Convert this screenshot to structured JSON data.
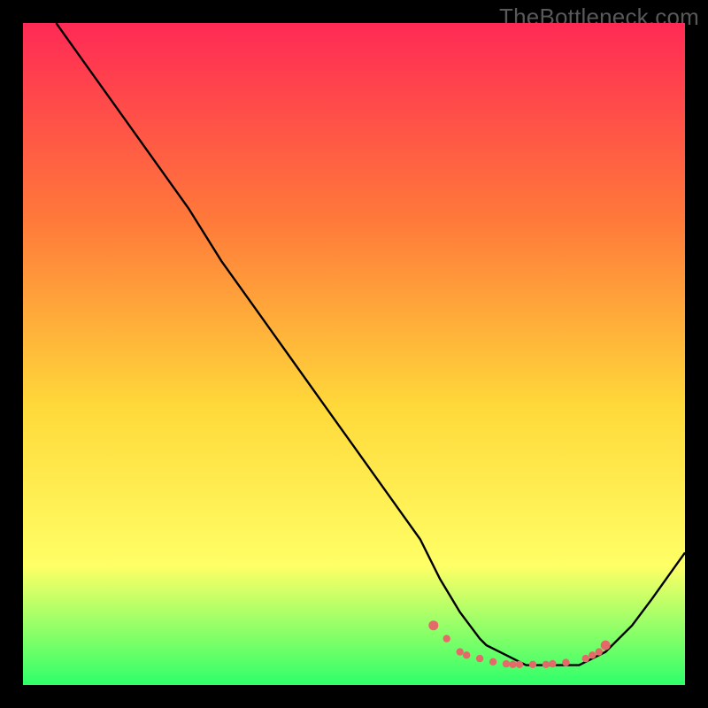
{
  "watermark": "TheBottleneck.com",
  "colors": {
    "frame": "#000000",
    "gradient_top": "#ff2a55",
    "gradient_mid1": "#ff7a3a",
    "gradient_mid2": "#ffd93a",
    "gradient_mid3": "#ffff66",
    "gradient_bottom": "#2eff6a",
    "curve": "#000000",
    "dots": "#e46a6a"
  },
  "chart_data": {
    "type": "line",
    "title": "",
    "xlabel": "",
    "ylabel": "",
    "xlim": [
      0,
      100
    ],
    "ylim": [
      0,
      100
    ],
    "series": [
      {
        "name": "bottleneck-curve",
        "x": [
          5,
          10,
          15,
          20,
          25,
          30,
          35,
          40,
          45,
          50,
          55,
          60,
          63,
          66,
          69,
          70,
          72,
          74,
          76,
          78,
          80,
          82,
          84,
          86,
          88,
          90,
          92,
          95,
          100
        ],
        "y": [
          100,
          93,
          86,
          79,
          72,
          64,
          57,
          50,
          43,
          36,
          29,
          22,
          16,
          11,
          7,
          6,
          5,
          4,
          3,
          3,
          3,
          3,
          3,
          4,
          5,
          7,
          9,
          13,
          20
        ]
      }
    ],
    "highlight_points": {
      "name": "windows-gpu-cpu-dots",
      "x": [
        62,
        64,
        66,
        67,
        69,
        71,
        73,
        74,
        75,
        77,
        79,
        80,
        82,
        85,
        86,
        87,
        88
      ],
      "y": [
        9,
        7,
        5,
        4.5,
        4,
        3.5,
        3.2,
        3.1,
        3.1,
        3.1,
        3.1,
        3.2,
        3.4,
        4,
        4.5,
        5,
        6
      ]
    }
  }
}
